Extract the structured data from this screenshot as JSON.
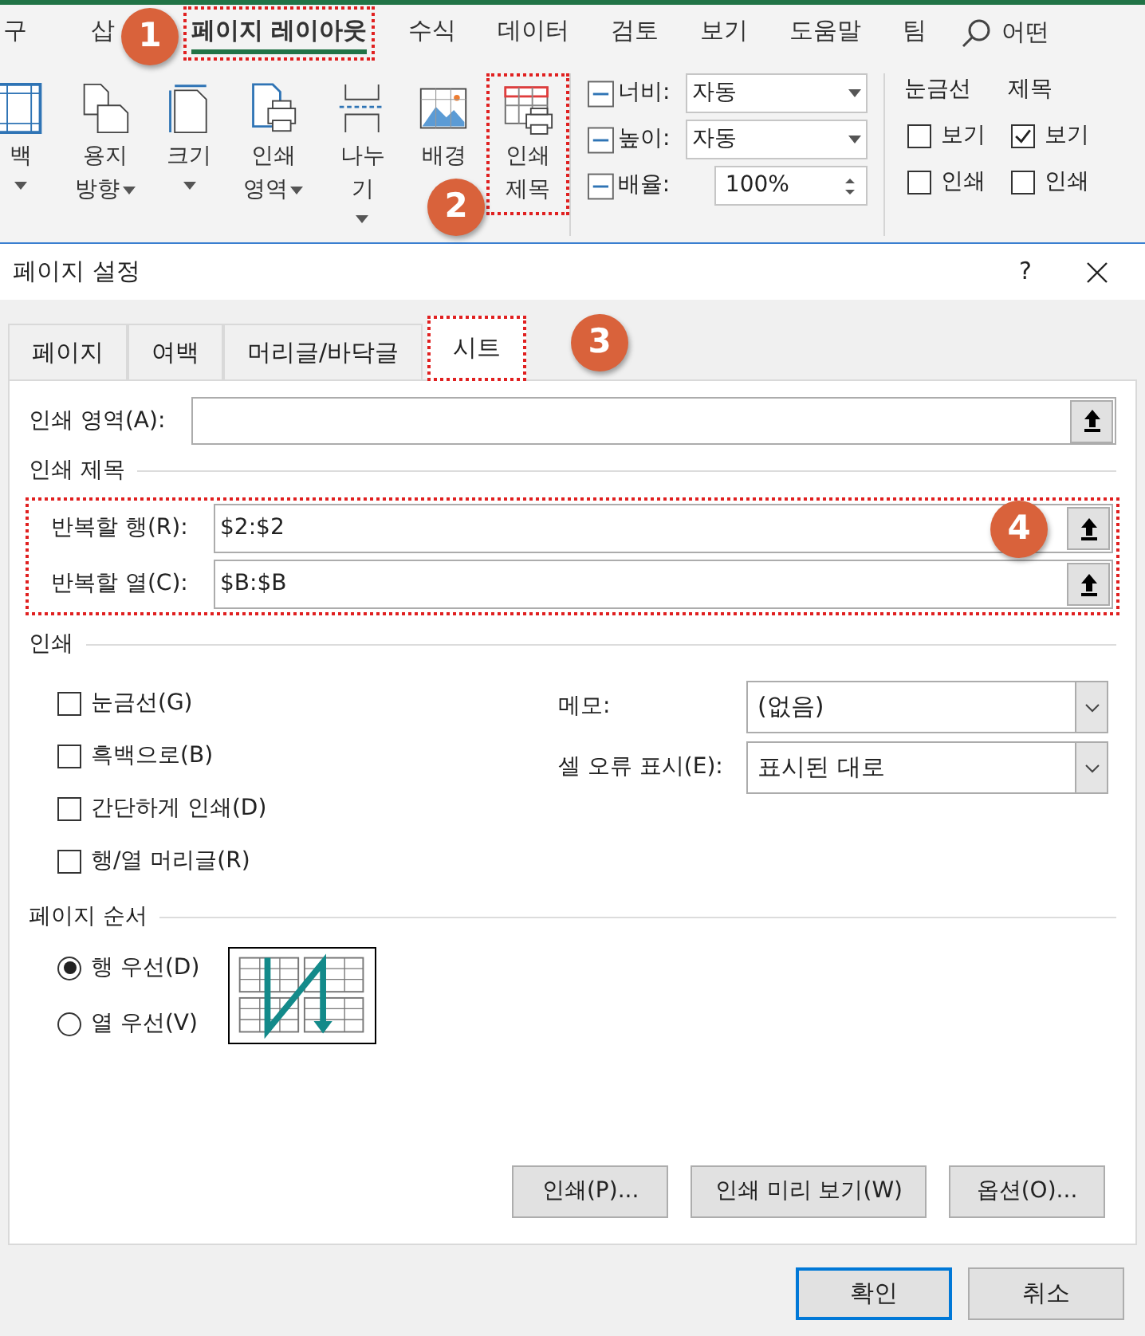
{
  "ribbon_tabs": [
    {
      "label": "구",
      "selected": false,
      "highlighted": false
    },
    {
      "label": "삽",
      "selected": false,
      "highlighted": false
    },
    {
      "label": "페이지 레이아웃",
      "selected": true,
      "highlighted": true
    },
    {
      "label": "수식",
      "selected": false,
      "highlighted": false
    },
    {
      "label": "데이터",
      "selected": false,
      "highlighted": false
    },
    {
      "label": "검토",
      "selected": false,
      "highlighted": false
    },
    {
      "label": "보기",
      "selected": false,
      "highlighted": false
    },
    {
      "label": "도움말",
      "selected": false,
      "highlighted": false
    },
    {
      "label": "팀",
      "selected": false,
      "highlighted": false
    }
  ],
  "search_label": "어떤",
  "page_setup_group": {
    "buttons": [
      {
        "label": "백",
        "kind": "margins",
        "has_menu": true,
        "menu_below": true,
        "highlighted": false
      },
      {
        "label": "용지 방향",
        "kind": "orientation",
        "has_menu": true,
        "menu_below": false,
        "highlighted": false
      },
      {
        "label": "크기",
        "kind": "size",
        "has_menu": true,
        "menu_below": true,
        "highlighted": false
      },
      {
        "label": "인쇄 영역",
        "kind": "print-area",
        "has_menu": true,
        "menu_below": false,
        "highlighted": false
      },
      {
        "label": "나누기",
        "kind": "breaks",
        "has_menu": true,
        "menu_below": true,
        "highlighted": false
      },
      {
        "label": "배경",
        "kind": "background",
        "has_menu": false,
        "highlighted": false
      },
      {
        "label": "인쇄 제목",
        "kind": "print-titles",
        "has_menu": false,
        "highlighted": true
      }
    ]
  },
  "scale_group": {
    "rows": [
      {
        "label": "너비:",
        "value": "자동",
        "kind": "dropdown"
      },
      {
        "label": "높이:",
        "value": "자동",
        "kind": "dropdown"
      },
      {
        "label": "배율:",
        "value": "100%",
        "kind": "spinner"
      }
    ]
  },
  "sheet_options_group": {
    "columns": [
      {
        "heading": "눈금선",
        "items": [
          {
            "label": "보기",
            "checked": false
          },
          {
            "label": "인쇄",
            "checked": false
          }
        ]
      },
      {
        "heading": "제목",
        "items": [
          {
            "label": "보기",
            "checked": true
          },
          {
            "label": "인쇄",
            "checked": false
          }
        ]
      }
    ]
  },
  "dialog": {
    "title": "페이지 설정",
    "help": "?",
    "tabs": [
      {
        "label": "페이지",
        "selected": false,
        "highlighted": false
      },
      {
        "label": "여백",
        "selected": false,
        "highlighted": false
      },
      {
        "label": "머리글/바닥글",
        "selected": false,
        "highlighted": false
      },
      {
        "label": "시트",
        "selected": true,
        "highlighted": true
      }
    ],
    "print_area_label": "인쇄 영역(A):",
    "print_titles": {
      "heading": "인쇄 제목",
      "highlighted": true,
      "rows": [
        {
          "label": "반복할 행(R):",
          "value": "$2:$2"
        },
        {
          "label": "반복할 열(C):",
          "value": "$B:$B"
        }
      ]
    },
    "print": {
      "heading": "인쇄",
      "checkboxes": [
        {
          "label": "눈금선(G)",
          "checked": false
        },
        {
          "label": "흑백으로(B)",
          "checked": false
        },
        {
          "label": "간단하게 인쇄(D)",
          "checked": false
        },
        {
          "label": "행/열 머리글(R)",
          "checked": false
        }
      ],
      "dropdowns": [
        {
          "label": "메모:",
          "value": "(없음)"
        },
        {
          "label": "셀 오류 표시(E):",
          "value": "표시된 대로"
        }
      ]
    },
    "page_order": {
      "heading": "페이지 순서",
      "options": [
        {
          "label": "행 우선(D)",
          "selected": true
        },
        {
          "label": "열 우선(V)",
          "selected": false
        }
      ]
    },
    "panel_buttons": [
      "인쇄(P)...",
      "인쇄 미리 보기(W)",
      "옵션(O)..."
    ],
    "footer_buttons": [
      {
        "label": "확인",
        "default": true
      },
      {
        "label": "취소",
        "default": false
      }
    ]
  },
  "callouts": [
    "1",
    "2",
    "3",
    "4"
  ]
}
